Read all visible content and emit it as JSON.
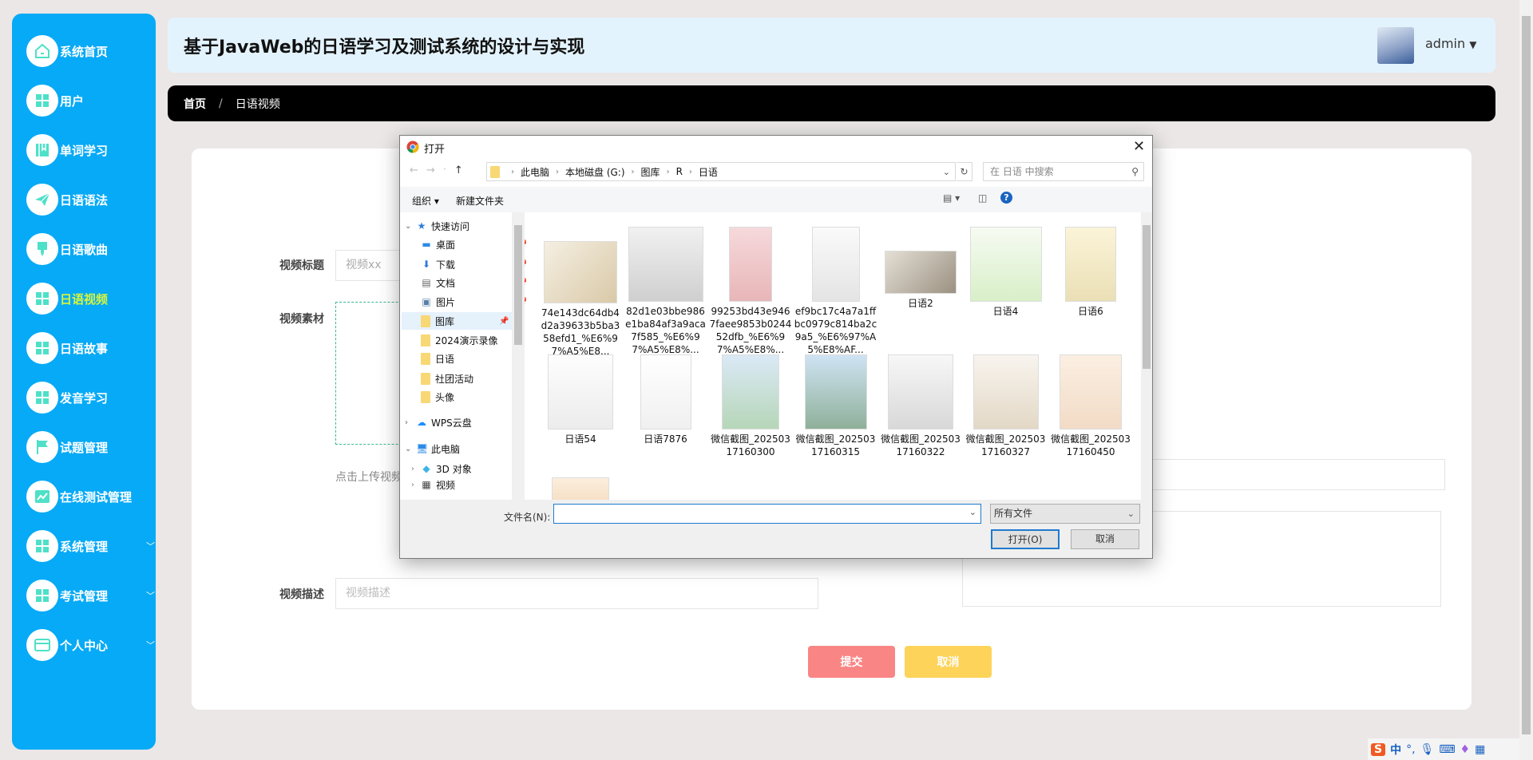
{
  "sidebar": {
    "active_color": "#d8f53a",
    "icon_color": "#4fe0c8",
    "items": [
      {
        "label": "系统首页",
        "icon": "house-icon"
      },
      {
        "label": "用户",
        "icon": "grid-icon"
      },
      {
        "label": "单词学习",
        "icon": "book-icon"
      },
      {
        "label": "日语语法",
        "icon": "paper-plane-icon"
      },
      {
        "label": "日语歌曲",
        "icon": "brush-icon"
      },
      {
        "label": "日语视频",
        "icon": "grid-icon",
        "active": true
      },
      {
        "label": "日语故事",
        "icon": "grid-icon"
      },
      {
        "label": "发音学习",
        "icon": "grid-icon"
      },
      {
        "label": "试题管理",
        "icon": "flag-icon"
      },
      {
        "label": "在线测试管理",
        "icon": "chart-icon"
      },
      {
        "label": "系统管理",
        "icon": "grid-icon",
        "expandable": true
      },
      {
        "label": "考试管理",
        "icon": "grid-icon",
        "expandable": true
      },
      {
        "label": "个人中心",
        "icon": "card-icon",
        "expandable": true
      }
    ]
  },
  "header": {
    "title": "基于JavaWeb的日语学习及测试系统的设计与实现",
    "user": "admin"
  },
  "breadcrumb": {
    "home": "首页",
    "current": "日语视频"
  },
  "form": {
    "title_label": "视频标题",
    "title_placeholder": "视频xx",
    "material_label": "视频素材",
    "upload_hint": "点击上传视频",
    "desc_label": "视频描述",
    "desc_placeholder": "视频描述",
    "submit": "提交",
    "cancel": "取消"
  },
  "dialog": {
    "title": "打开",
    "path": [
      "此电脑",
      "本地磁盘 (G:)",
      "图库",
      "R",
      "日语"
    ],
    "search_placeholder": "在 日语 中搜索",
    "organize": "组织 ▾",
    "new_folder": "新建文件夹",
    "nav": [
      {
        "label": "快速访问",
        "type": "header",
        "expanded": true
      },
      {
        "label": "桌面",
        "pinned": true
      },
      {
        "label": "下载",
        "pinned": true
      },
      {
        "label": "文档",
        "pinned": true
      },
      {
        "label": "图片",
        "pinned": true
      },
      {
        "label": "图库",
        "pinned": true,
        "selected": true
      },
      {
        "label": "2024演示录像"
      },
      {
        "label": "日语"
      },
      {
        "label": "社团活动"
      },
      {
        "label": "头像"
      },
      {
        "label": "WPS云盘",
        "type": "header"
      },
      {
        "label": "此电脑",
        "type": "header",
        "expanded": true
      },
      {
        "label": "3D 对象",
        "type": "child"
      },
      {
        "label": "视频",
        "type": "child"
      }
    ],
    "files": [
      {
        "name": "74e143dc64db4d2a39633b5ba358efd1_%E6%97%A5%E8..."
      },
      {
        "name": "82d1e03bbe986e1ba84af3a9aca7f585_%E6%97%A5%E8%..."
      },
      {
        "name": "99253bd43e9467faee9853b024452dfb_%E6%97%A5%E8%..."
      },
      {
        "name": "ef9bc17c4a7a1ffbc0979c814ba2c9a5_%E6%97%A5%E8%AF..."
      },
      {
        "name": "日语2"
      },
      {
        "name": "日语4"
      },
      {
        "name": "日语6"
      },
      {
        "name": "日语54"
      },
      {
        "name": "日语7876"
      },
      {
        "name": "微信截图_20250317160300"
      },
      {
        "name": "微信截图_20250317160315"
      },
      {
        "name": "微信截图_20250317160322"
      },
      {
        "name": "微信截图_20250317160327"
      },
      {
        "name": "微信截图_20250317160450"
      },
      {
        "name": ""
      }
    ],
    "filename_label": "文件名(N):",
    "filename_value": "",
    "filetype": "所有文件",
    "open": "打开(O)",
    "cancel": "取消"
  },
  "ime": {
    "mode": "中"
  }
}
